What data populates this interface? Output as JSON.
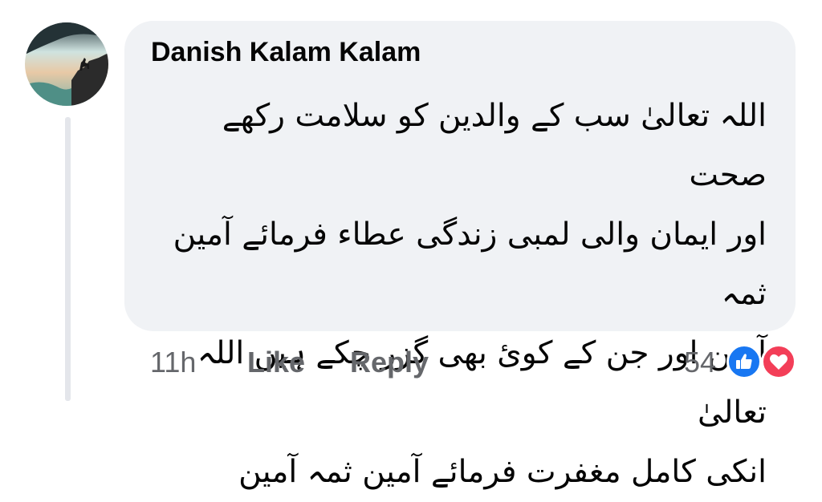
{
  "comment": {
    "author": "Danish Kalam Kalam",
    "lines": [
      "اللہ تعالیٰ سب کے والدین کو سلامت رکھے صحت",
      "اور ایمان والی لمبی زندگی عطاء فرمائے آمین ثمہ",
      "آمین اور جن کے کوئ بھی گزر چکے ہیں اللہ تعالیٰ",
      "انکی کامل مغفرت فرمائے آمین ثمہ آمین"
    ]
  },
  "actions": {
    "timestamp": "11h",
    "like_label": "Like",
    "reply_label": "Reply"
  },
  "reactions": {
    "count": "54",
    "types": [
      "like-icon",
      "love-icon"
    ],
    "colors": {
      "like": "#1877f2",
      "love": "#f33e58"
    }
  }
}
